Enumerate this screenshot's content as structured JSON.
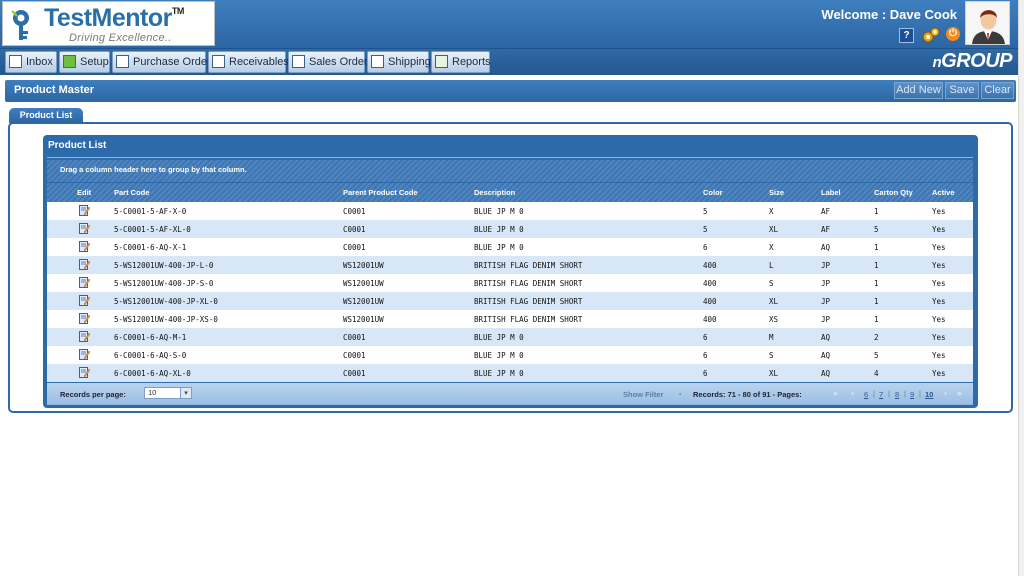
{
  "app": {
    "logo_name": "TestMentor",
    "logo_tm": "TM",
    "logo_tagline": "Driving Excellence..",
    "welcome": "Welcome : Dave Cook",
    "help_glyph": "?",
    "brand": "GROUP",
    "brand_prefix": "n"
  },
  "nav": {
    "items": [
      {
        "label": "Inbox",
        "icon": "inbox-icon"
      },
      {
        "label": "Setup",
        "icon": "gear-icon"
      },
      {
        "label": "Purchase Order",
        "icon": "document-icon"
      },
      {
        "label": "Receivables",
        "icon": "document-icon"
      },
      {
        "label": "Sales Order",
        "icon": "document-icon"
      },
      {
        "label": "Shipping",
        "icon": "document-icon"
      },
      {
        "label": "Reports",
        "icon": "chart-icon"
      }
    ]
  },
  "page": {
    "title": "Product Master",
    "add_new": "Add New",
    "save": "Save",
    "clear": "Clear",
    "tab": "Product List"
  },
  "grid": {
    "title": "Product List",
    "group_hint": "Drag a column header here to group by that column.",
    "columns": [
      "Edit",
      "Part Code",
      "Parent Product Code",
      "Description",
      "Color",
      "Size",
      "Label",
      "Carton Qty",
      "Active"
    ],
    "rows": [
      [
        "5-C0001-5-AF-X-0",
        "C0001",
        "BLUE JP M 0",
        "5",
        "X",
        "AF",
        "1",
        "Yes"
      ],
      [
        "5-C0001-5-AF-XL-0",
        "C0001",
        "BLUE JP M 0",
        "5",
        "XL",
        "AF",
        "5",
        "Yes"
      ],
      [
        "5-C0001-6-AQ-X-1",
        "C0001",
        "BLUE JP M 0",
        "6",
        "X",
        "AQ",
        "1",
        "Yes"
      ],
      [
        "5-WS12001UW-400-JP-L-0",
        "WS12001UW",
        "BRITISH FLAG DENIM SHORT",
        "400",
        "L",
        "JP",
        "1",
        "Yes"
      ],
      [
        "5-WS12001UW-400-JP-S-0",
        "WS12001UW",
        "BRITISH FLAG DENIM SHORT",
        "400",
        "S",
        "JP",
        "1",
        "Yes"
      ],
      [
        "5-WS12001UW-400-JP-XL-0",
        "WS12001UW",
        "BRITISH FLAG DENIM SHORT",
        "400",
        "XL",
        "JP",
        "1",
        "Yes"
      ],
      [
        "5-WS12001UW-400-JP-XS-0",
        "WS12001UW",
        "BRITISH FLAG DENIM SHORT",
        "400",
        "XS",
        "JP",
        "1",
        "Yes"
      ],
      [
        "6-C0001-6-AQ-M-1",
        "C0001",
        "BLUE JP M 0",
        "6",
        "M",
        "AQ",
        "2",
        "Yes"
      ],
      [
        "6-C0001-6-AQ-S-0",
        "C0001",
        "BLUE JP M 0",
        "6",
        "S",
        "AQ",
        "5",
        "Yes"
      ],
      [
        "6-C0001-6-AQ-XL-0",
        "C0001",
        "BLUE JP M 0",
        "6",
        "XL",
        "AQ",
        "4",
        "Yes"
      ]
    ],
    "footer": {
      "records_per_page_label": "Records per page:",
      "records_per_page_value": "10",
      "show_filter": "Show Filter",
      "dash": "-",
      "records_info": "Records: 71 - 80 of 91 - Pages:",
      "pages": [
        "6",
        "7",
        "8",
        "9",
        "10"
      ],
      "current_page": "10",
      "first_glyph": "«",
      "prev_glyph": "‹",
      "next_glyph": "›",
      "last_glyph": "»"
    }
  },
  "colors": {
    "header_blue": "#2c65a3",
    "row_odd": "#ffffff",
    "row_even": "#d7e7f7"
  }
}
